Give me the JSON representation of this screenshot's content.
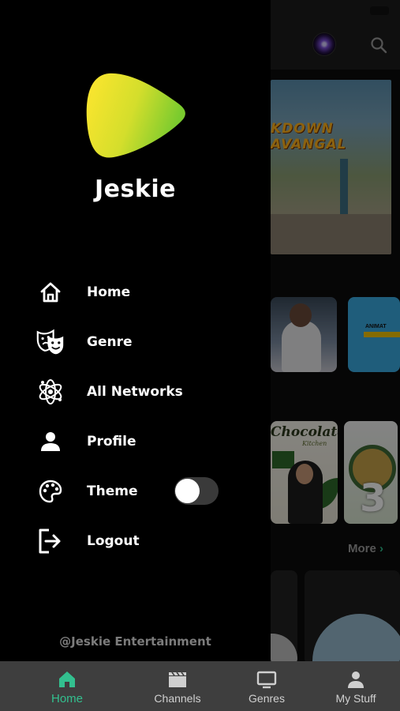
{
  "drawer": {
    "brand": "Jeskie",
    "menu": [
      {
        "label": "Home",
        "icon": "home-icon"
      },
      {
        "label": "Genre",
        "icon": "theater-masks-icon"
      },
      {
        "label": "All Networks",
        "icon": "network-atom-icon"
      },
      {
        "label": "Profile",
        "icon": "person-icon"
      },
      {
        "label": "Theme",
        "icon": "palette-icon",
        "toggle_on": false
      },
      {
        "label": "Logout",
        "icon": "logout-icon"
      }
    ],
    "footer": "@Jeskie Entertainment"
  },
  "background": {
    "hero_title_line1": "KDOWN",
    "hero_title_line2": "AVANGAL",
    "thumb_animation_label": "ANIMAT",
    "thumb_chocolata_title": "Chocolata",
    "thumb_chocolata_sub": "Kitchen",
    "thumb_number": "3",
    "more_label": "More",
    "more_chevron": "›"
  },
  "bottom_nav": [
    {
      "label": "Home",
      "icon": "home-filled-icon",
      "active": true
    },
    {
      "label": "Channels",
      "icon": "clapperboard-icon",
      "active": false
    },
    {
      "label": "Genres",
      "icon": "tv-icon",
      "active": false
    },
    {
      "label": "My Stuff",
      "icon": "person-icon",
      "active": false
    }
  ],
  "colors": {
    "accent": "#33C08F",
    "logo_gradient_start": "#FFE62E",
    "logo_gradient_end": "#7ACB2E",
    "drawer_bg": "#000000",
    "bottom_nav_bg": "#3E3E3E"
  }
}
